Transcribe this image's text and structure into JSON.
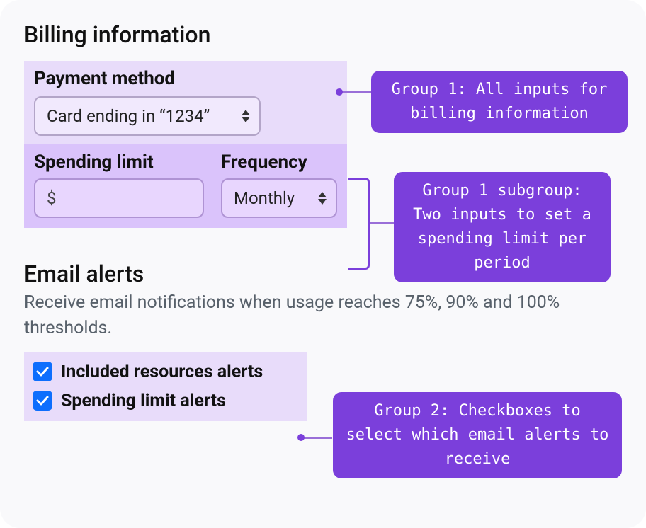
{
  "billing": {
    "title": "Billing information",
    "payment_method": {
      "label": "Payment method",
      "selected": "Card ending in “1234”"
    },
    "spending_limit": {
      "label": "Spending limit",
      "prefix": "$"
    },
    "frequency": {
      "label": "Frequency",
      "selected": "Monthly"
    }
  },
  "email_alerts": {
    "title": "Email alerts",
    "description": "Receive email notifications when usage reaches 75%, 90% and 100% thresholds.",
    "options": [
      {
        "label": "Included resources alerts",
        "checked": true
      },
      {
        "label": "Spending limit alerts",
        "checked": true
      }
    ]
  },
  "callouts": {
    "group1": "Group 1: All inputs for billing information",
    "group1_sub": "Group 1 subgroup: Two inputs to set a spending limit per period",
    "group2": "Group 2: Checkboxes to select which email alerts to receive"
  }
}
